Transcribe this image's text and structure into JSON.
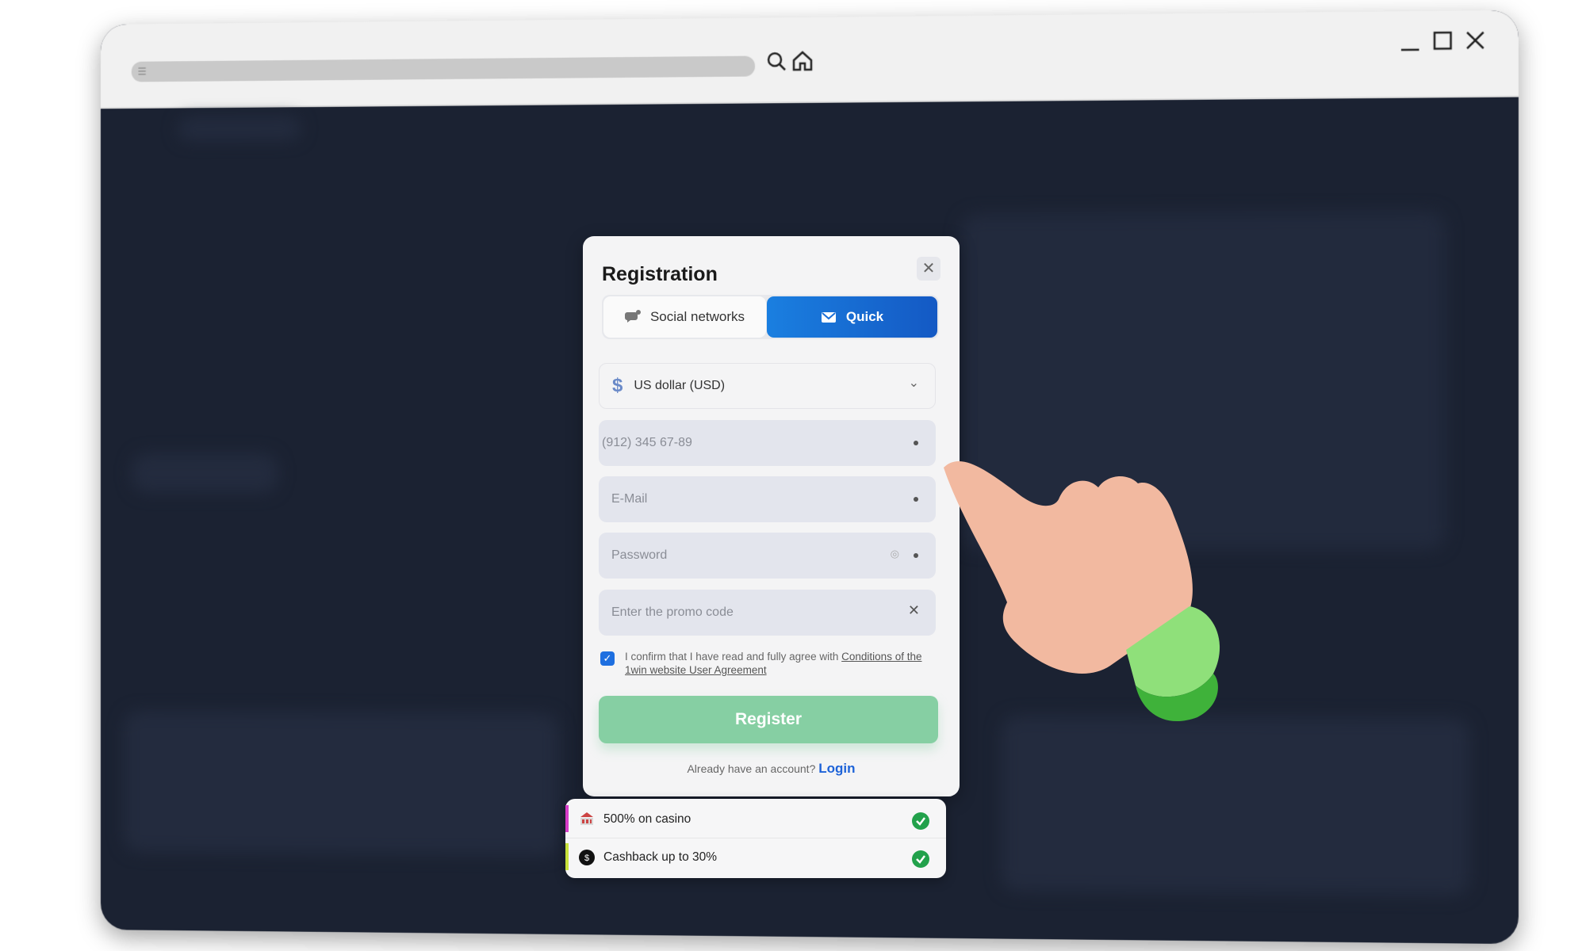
{
  "browser": {
    "icons": [
      "settings-icon",
      "search-icon",
      "home-icon",
      "minimize-icon",
      "maximize-icon",
      "close-icon"
    ]
  },
  "dialog": {
    "title": "Registration",
    "tabs": [
      {
        "label": "Social networks",
        "icon": "chat-bubble-icon",
        "active": false
      },
      {
        "label": "Quick",
        "icon": "envelope-icon",
        "active": true
      }
    ],
    "currency": {
      "value": "US dollar (USD)",
      "icon": "dollar-icon"
    },
    "phone": {
      "placeholder": "(912) 345 67-89"
    },
    "email": {
      "placeholder": "E-Mail"
    },
    "password": {
      "placeholder": "Password"
    },
    "promo": {
      "placeholder": "Enter the promo code"
    },
    "agreement": {
      "checked": true,
      "text": "I confirm that I have read and fully agree with ",
      "link": "Conditions of the 1win website User Agreement"
    },
    "register_label": "Register",
    "have_account": "Already have an account?",
    "login_label": "Login",
    "colors": {
      "accent": "#1a6fd8",
      "register": "#86cfa3",
      "success": "#22a14b",
      "background": "#1b2232"
    }
  },
  "bonuses": [
    {
      "label": "500% on casino",
      "icon": "casino-icon",
      "accent": "#d63cc8"
    },
    {
      "label": "Cashback up to 30%",
      "icon": "cashback-icon",
      "accent": "#c8e23a"
    }
  ]
}
